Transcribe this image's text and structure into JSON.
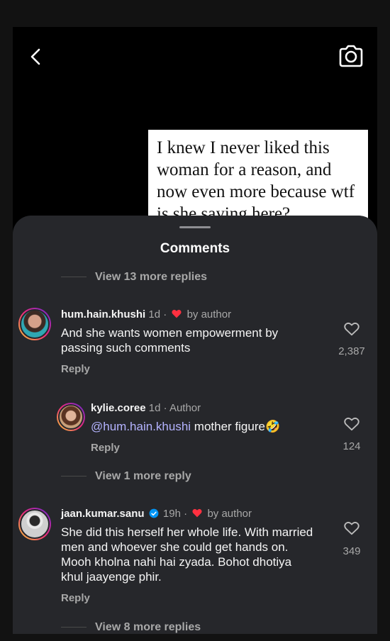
{
  "post": {
    "text": "I knew I never liked this woman for a reason, and now even more because wtf is she saying here?"
  },
  "sheet": {
    "title": "Comments",
    "view_more_top": "View 13 more replies",
    "view_more_middle": "View 1 more reply",
    "view_more_bottom": "View 8 more replies"
  },
  "comments": [
    {
      "username": "hum.hain.khushi",
      "time": "1d",
      "separator": "·",
      "badge": "by author",
      "text": "And she wants women empowerment by passing such comments",
      "reply_label": "Reply",
      "likes": "2,387"
    },
    {
      "username": "kylie.coree",
      "time": "1d",
      "separator": "·",
      "badge": "Author",
      "mention": "@hum.hain.khushi",
      "text": " mother figure🤣",
      "reply_label": "Reply",
      "likes": "124"
    },
    {
      "username": "jaan.kumar.sanu",
      "time": "19h",
      "separator": "·",
      "badge": "by author",
      "text": "She did this herself her whole life. With married men and whoever she could get hands on. Mooh kholna nahi hai zyada. Bohot dhotiya khul jaayenge phir.",
      "reply_label": "Reply",
      "likes": "349"
    }
  ],
  "colors": {
    "sheet_bg": "#26272b",
    "liked_heart": "#ff3040",
    "mention": "#b4b3ff",
    "verified": "#0095f6"
  },
  "icons": [
    "back-arrow-icon",
    "camera-icon",
    "heart-icon",
    "red-heart-icon",
    "verified-badge-icon"
  ]
}
